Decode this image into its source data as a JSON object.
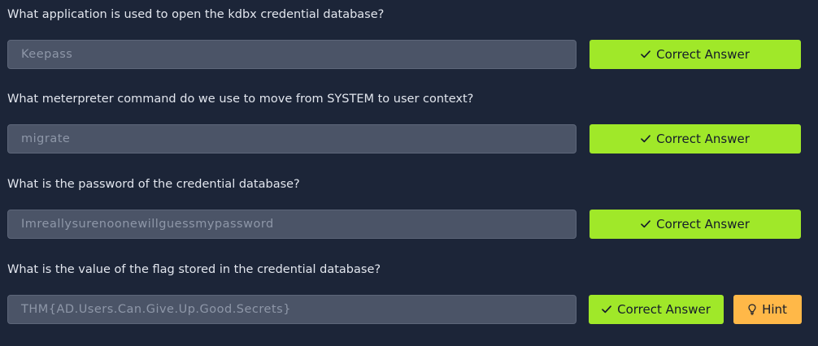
{
  "questions": [
    {
      "question": "What application is used to open the kdbx credential database?",
      "answer": "Keepass",
      "button_label": "Correct Answer"
    },
    {
      "question": "What meterpreter command do we use to move from SYSTEM to user context?",
      "answer": "migrate",
      "button_label": "Correct Answer"
    },
    {
      "question": "What is the password of the credential database?",
      "answer": "Imreallysurenoonewillguessmypassword",
      "button_label": "Correct Answer"
    },
    {
      "question": "What is the value of the flag stored in the credential database?",
      "answer": "THM{AD.Users.Can.Give.Up.Good.Secrets}",
      "button_label": "Correct Answer",
      "hint_label": "Hint"
    }
  ],
  "icons": {
    "correct": "check-icon",
    "hint": "lightbulb-icon"
  },
  "colors": {
    "background": "#1c2538",
    "correct_button": "#a0e829",
    "hint_button": "#ffb848",
    "answer_field": "#4b5467"
  }
}
